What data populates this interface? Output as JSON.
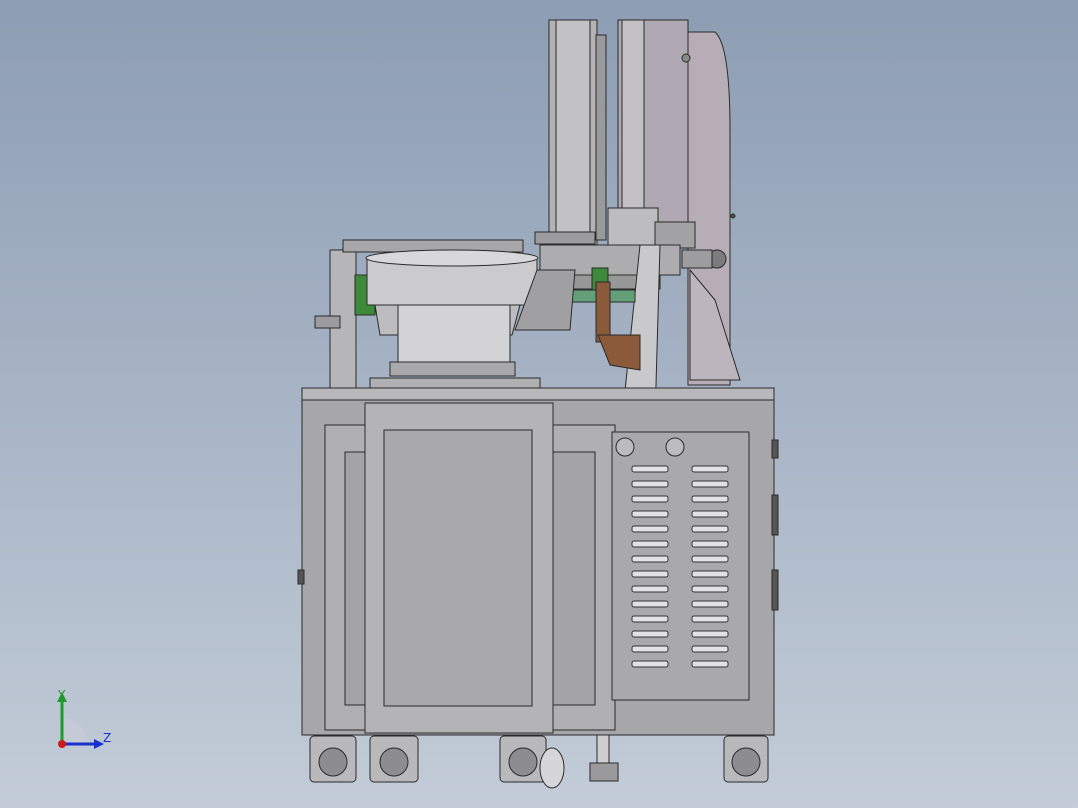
{
  "viewport": {
    "background_top": "#8d9db3",
    "background_bottom": "#c3ccd8"
  },
  "triad": {
    "y_label": "Y",
    "z_label": "Z",
    "y_color": "#1f9a2c",
    "z_color": "#1a2fd0",
    "x_color": "#d01a1a"
  },
  "model": {
    "body_color": "#a9a9ab",
    "highlight_green": "#3c8a3a",
    "accent_brown": "#8a5a3a"
  }
}
